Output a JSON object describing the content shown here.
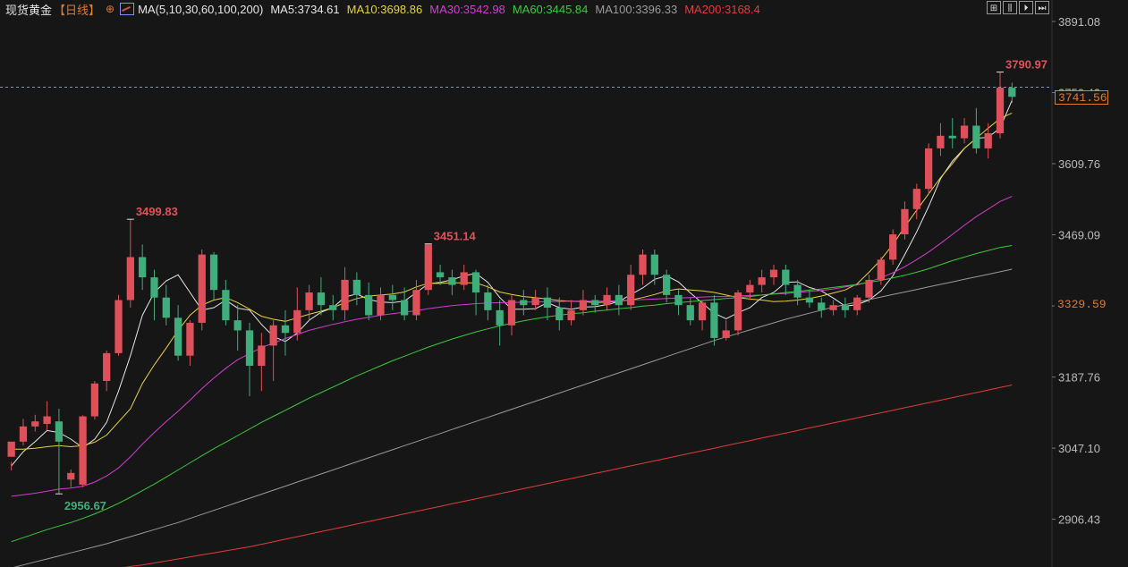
{
  "header": {
    "title": "现货黄金",
    "period": "【日线】",
    "circle_glyph": "⊕",
    "ma_config": "MA(5,10,30,60,100,200)",
    "ma_values": [
      {
        "label": "MA5:3734.61",
        "color": "#e6e6e6"
      },
      {
        "label": "MA10:3698.86",
        "color": "#e8d23c"
      },
      {
        "label": "MA30:3542.98",
        "color": "#d23cd2"
      },
      {
        "label": "MA60:3445.84",
        "color": "#3cc83c"
      },
      {
        "label": "MA100:3396.33",
        "color": "#9a9a9a"
      },
      {
        "label": "MA200:3168.4",
        "color": "#e03c3c"
      }
    ]
  },
  "toolbar": [
    "⊞",
    "⫼",
    "⏵",
    "⏭"
  ],
  "price_tags": {
    "last": "3741.56",
    "hline": "3329.59"
  },
  "colors": {
    "up": "#e0505a",
    "down": "#3fae7c",
    "hl_high": "#e0505a",
    "hl_low": "#3fae7c",
    "last_line": "#e07a2c",
    "ma5": "#e6e6e6",
    "ma10": "#e8d23c",
    "ma30": "#d23cd2",
    "ma60": "#3cc83c",
    "ma100": "#9a9a9a",
    "ma200": "#e03c3c"
  },
  "chart_data": {
    "type": "candlestick",
    "y_ticks": [
      3891.08,
      3750.42,
      3609.76,
      3469.09,
      3328.43,
      3187.76,
      3047.1,
      2906.43
    ],
    "ylim": [
      2812,
      3891.08
    ],
    "annotations": [
      {
        "label": "3790.97",
        "value": 3790.97,
        "kind": "high",
        "index": 83
      },
      {
        "label": "3499.83",
        "value": 3499.83,
        "kind": "high",
        "index": 10
      },
      {
        "label": "3451.14",
        "value": 3451.14,
        "kind": "high",
        "index": 35
      },
      {
        "label": "2956.67",
        "value": 2956.67,
        "kind": "low",
        "index": 4
      }
    ],
    "last_price": 3741.56,
    "hline_price": 3329.59,
    "candles": [
      [
        3030,
        3060,
        3020,
        3003
      ],
      [
        3060,
        3090,
        3105,
        3052
      ],
      [
        3090,
        3100,
        3113,
        3080
      ],
      [
        3095,
        3110,
        3140,
        3082
      ],
      [
        3100,
        3060,
        3125,
        2957
      ],
      [
        2985,
        2998,
        3005,
        2970
      ],
      [
        2975,
        3110,
        3112,
        2970
      ],
      [
        3110,
        3175,
        3180,
        3104
      ],
      [
        3180,
        3235,
        3240,
        3160
      ],
      [
        3235,
        3340,
        3350,
        3230
      ],
      [
        3340,
        3425,
        3500,
        3325
      ],
      [
        3425,
        3385,
        3450,
        3360
      ],
      [
        3385,
        3345,
        3400,
        3300
      ],
      [
        3345,
        3305,
        3370,
        3290
      ],
      [
        3305,
        3230,
        3330,
        3220
      ],
      [
        3230,
        3295,
        3300,
        3210
      ],
      [
        3295,
        3430,
        3440,
        3280
      ],
      [
        3430,
        3360,
        3435,
        3340
      ],
      [
        3360,
        3300,
        3380,
        3290
      ],
      [
        3300,
        3280,
        3330,
        3240
      ],
      [
        3280,
        3210,
        3295,
        3150
      ],
      [
        3210,
        3250,
        3275,
        3160
      ],
      [
        3250,
        3290,
        3300,
        3180
      ],
      [
        3290,
        3275,
        3320,
        3230
      ],
      [
        3275,
        3320,
        3365,
        3260
      ],
      [
        3320,
        3355,
        3370,
        3300
      ],
      [
        3355,
        3330,
        3385,
        3310
      ],
      [
        3330,
        3320,
        3350,
        3300
      ],
      [
        3320,
        3380,
        3405,
        3300
      ],
      [
        3380,
        3350,
        3395,
        3330
      ],
      [
        3350,
        3310,
        3375,
        3300
      ],
      [
        3310,
        3350,
        3365,
        3300
      ],
      [
        3350,
        3340,
        3370,
        3320
      ],
      [
        3340,
        3310,
        3365,
        3300
      ],
      [
        3310,
        3360,
        3380,
        3300
      ],
      [
        3360,
        3450,
        3451,
        3350
      ],
      [
        3395,
        3385,
        3410,
        3370
      ],
      [
        3385,
        3370,
        3400,
        3350
      ],
      [
        3370,
        3395,
        3410,
        3360
      ],
      [
        3395,
        3355,
        3400,
        3310
      ],
      [
        3355,
        3320,
        3370,
        3300
      ],
      [
        3320,
        3290,
        3340,
        3250
      ],
      [
        3290,
        3340,
        3350,
        3270
      ],
      [
        3340,
        3330,
        3360,
        3310
      ],
      [
        3330,
        3345,
        3360,
        3320
      ],
      [
        3345,
        3325,
        3365,
        3300
      ],
      [
        3325,
        3300,
        3345,
        3280
      ],
      [
        3300,
        3320,
        3340,
        3290
      ],
      [
        3320,
        3340,
        3360,
        3310
      ],
      [
        3340,
        3330,
        3350,
        3315
      ],
      [
        3330,
        3350,
        3365,
        3320
      ],
      [
        3350,
        3330,
        3370,
        3310
      ],
      [
        3330,
        3390,
        3410,
        3320
      ],
      [
        3390,
        3430,
        3440,
        3370
      ],
      [
        3430,
        3390,
        3440,
        3370
      ],
      [
        3390,
        3350,
        3400,
        3335
      ],
      [
        3350,
        3330,
        3360,
        3310
      ],
      [
        3330,
        3300,
        3345,
        3290
      ],
      [
        3300,
        3335,
        3340,
        3280
      ],
      [
        3335,
        3265,
        3350,
        3250
      ],
      [
        3265,
        3280,
        3300,
        3260
      ],
      [
        3280,
        3355,
        3360,
        3270
      ],
      [
        3355,
        3370,
        3380,
        3340
      ],
      [
        3370,
        3385,
        3400,
        3355
      ],
      [
        3385,
        3400,
        3410,
        3370
      ],
      [
        3400,
        3370,
        3410,
        3350
      ],
      [
        3370,
        3345,
        3380,
        3330
      ],
      [
        3345,
        3335,
        3360,
        3325
      ],
      [
        3335,
        3320,
        3345,
        3305
      ],
      [
        3320,
        3330,
        3340,
        3310
      ],
      [
        3330,
        3320,
        3345,
        3305
      ],
      [
        3320,
        3345,
        3350,
        3310
      ],
      [
        3345,
        3380,
        3390,
        3335
      ],
      [
        3380,
        3420,
        3425,
        3370
      ],
      [
        3420,
        3470,
        3480,
        3410
      ],
      [
        3470,
        3520,
        3535,
        3460
      ],
      [
        3520,
        3560,
        3570,
        3500
      ],
      [
        3560,
        3640,
        3650,
        3550
      ],
      [
        3640,
        3665,
        3690,
        3625
      ],
      [
        3665,
        3660,
        3700,
        3640
      ],
      [
        3660,
        3685,
        3700,
        3650
      ],
      [
        3685,
        3640,
        3720,
        3630
      ],
      [
        3640,
        3670,
        3690,
        3620
      ],
      [
        3670,
        3760,
        3791,
        3660
      ],
      [
        3760,
        3742,
        3770,
        3730
      ]
    ],
    "ma_series": [
      {
        "name": "MA5",
        "values": [
          3012,
          3040,
          3060,
          3082,
          3078,
          3065,
          3048,
          3065,
          3098,
          3160,
          3230,
          3310,
          3355,
          3378,
          3390,
          3355,
          3320,
          3325,
          3340,
          3324,
          3320,
          3292,
          3268,
          3258,
          3275,
          3300,
          3316,
          3325,
          3346,
          3352,
          3341,
          3336,
          3335,
          3338,
          3355,
          3372,
          3375,
          3380,
          3388,
          3393,
          3375,
          3345,
          3322,
          3322,
          3323,
          3335,
          3325,
          3322,
          3326,
          3327,
          3331,
          3337,
          3351,
          3364,
          3381,
          3388,
          3376,
          3354,
          3334,
          3314,
          3303,
          3315,
          3325,
          3345,
          3355,
          3375,
          3376,
          3365,
          3358,
          3344,
          3328,
          3331,
          3340,
          3358,
          3388,
          3430,
          3475,
          3525,
          3580,
          3615,
          3640,
          3660,
          3662,
          3680,
          3735
        ]
      },
      {
        "name": "MA10",
        "values": [
          3045,
          3045,
          3047,
          3050,
          3052,
          3050,
          3052,
          3059,
          3073,
          3099,
          3125,
          3175,
          3212,
          3245,
          3280,
          3310,
          3330,
          3340,
          3345,
          3335,
          3322,
          3308,
          3302,
          3298,
          3305,
          3312,
          3318,
          3325,
          3335,
          3343,
          3348,
          3350,
          3352,
          3356,
          3366,
          3373,
          3373,
          3374,
          3374,
          3374,
          3366,
          3356,
          3351,
          3347,
          3345,
          3342,
          3339,
          3338,
          3337,
          3335,
          3336,
          3338,
          3340,
          3345,
          3351,
          3358,
          3362,
          3360,
          3358,
          3355,
          3350,
          3345,
          3342,
          3340,
          3337,
          3338,
          3340,
          3343,
          3348,
          3354,
          3360,
          3372,
          3395,
          3420,
          3450,
          3485,
          3518,
          3550,
          3582,
          3610,
          3640,
          3660,
          3680,
          3699,
          3710
        ]
      },
      {
        "name": "MA30",
        "values": [
          2952,
          2955,
          2958,
          2962,
          2966,
          2968,
          2972,
          2980,
          2992,
          3008,
          3030,
          3055,
          3078,
          3100,
          3120,
          3142,
          3165,
          3186,
          3205,
          3222,
          3234,
          3246,
          3255,
          3264,
          3272,
          3280,
          3286,
          3292,
          3297,
          3302,
          3306,
          3310,
          3313,
          3316,
          3319,
          3323,
          3326,
          3329,
          3331,
          3333,
          3334,
          3335,
          3335,
          3336,
          3336,
          3337,
          3337,
          3338,
          3338,
          3338,
          3338,
          3339,
          3340,
          3341,
          3342,
          3343,
          3344,
          3345,
          3346,
          3347,
          3347,
          3348,
          3349,
          3350,
          3352,
          3353,
          3355,
          3357,
          3359,
          3362,
          3366,
          3370,
          3376,
          3384,
          3394,
          3406,
          3420,
          3435,
          3452,
          3470,
          3488,
          3505,
          3520,
          3535,
          3545
        ]
      },
      {
        "name": "MA60",
        "values": [
          2862,
          2870,
          2878,
          2886,
          2893,
          2900,
          2908,
          2917,
          2927,
          2938,
          2950,
          2963,
          2976,
          2990,
          3004,
          3018,
          3032,
          3046,
          3059,
          3072,
          3085,
          3098,
          3110,
          3122,
          3134,
          3146,
          3157,
          3168,
          3179,
          3190,
          3200,
          3210,
          3220,
          3229,
          3238,
          3247,
          3255,
          3263,
          3270,
          3277,
          3283,
          3289,
          3294,
          3299,
          3303,
          3307,
          3310,
          3313,
          3315,
          3318,
          3320,
          3323,
          3325,
          3328,
          3330,
          3333,
          3335,
          3337,
          3339,
          3341,
          3343,
          3345,
          3347,
          3350,
          3352,
          3355,
          3357,
          3360,
          3362,
          3365,
          3368,
          3371,
          3375,
          3379,
          3384,
          3389,
          3395,
          3402,
          3410,
          3418,
          3425,
          3432,
          3438,
          3444,
          3448
        ]
      },
      {
        "name": "MA100",
        "values": [
          2810,
          2816,
          2822,
          2828,
          2834,
          2840,
          2846,
          2852,
          2858,
          2865,
          2872,
          2879,
          2886,
          2893,
          2900,
          2908,
          2916,
          2924,
          2932,
          2940,
          2948,
          2956,
          2964,
          2972,
          2980,
          2988,
          2996,
          3004,
          3012,
          3020,
          3028,
          3036,
          3044,
          3052,
          3060,
          3068,
          3076,
          3084,
          3092,
          3100,
          3108,
          3116,
          3124,
          3132,
          3140,
          3148,
          3156,
          3164,
          3172,
          3180,
          3188,
          3196,
          3204,
          3212,
          3220,
          3228,
          3236,
          3244,
          3252,
          3260,
          3267,
          3274,
          3281,
          3288,
          3295,
          3302,
          3308,
          3314,
          3320,
          3326,
          3331,
          3336,
          3341,
          3346,
          3351,
          3356,
          3361,
          3366,
          3371,
          3376,
          3381,
          3386,
          3391,
          3396,
          3401
        ]
      },
      {
        "name": "MA200",
        "values": [
          2803,
          2806,
          2809,
          2813,
          2816,
          2820,
          2824,
          2828,
          2832,
          2836,
          2840,
          2844,
          2848,
          2852,
          2857,
          2862,
          2867,
          2872,
          2877,
          2882,
          2887,
          2892,
          2897,
          2902,
          2907,
          2912,
          2917,
          2922,
          2927,
          2932,
          2937,
          2942,
          2947,
          2952,
          2957,
          2962,
          2967,
          2972,
          2977,
          2982,
          2987,
          2992,
          2997,
          3002,
          3007,
          3012,
          3017,
          3022,
          3027,
          3032,
          3037,
          3042,
          3047,
          3052,
          3057,
          3062,
          3067,
          3072,
          3077,
          3082,
          3087,
          3092,
          3097,
          3102,
          3107,
          3112,
          3117,
          3122,
          3127,
          3132,
          3137,
          3142,
          3147,
          3152,
          3157,
          3162,
          3167,
          3172
        ]
      }
    ]
  }
}
